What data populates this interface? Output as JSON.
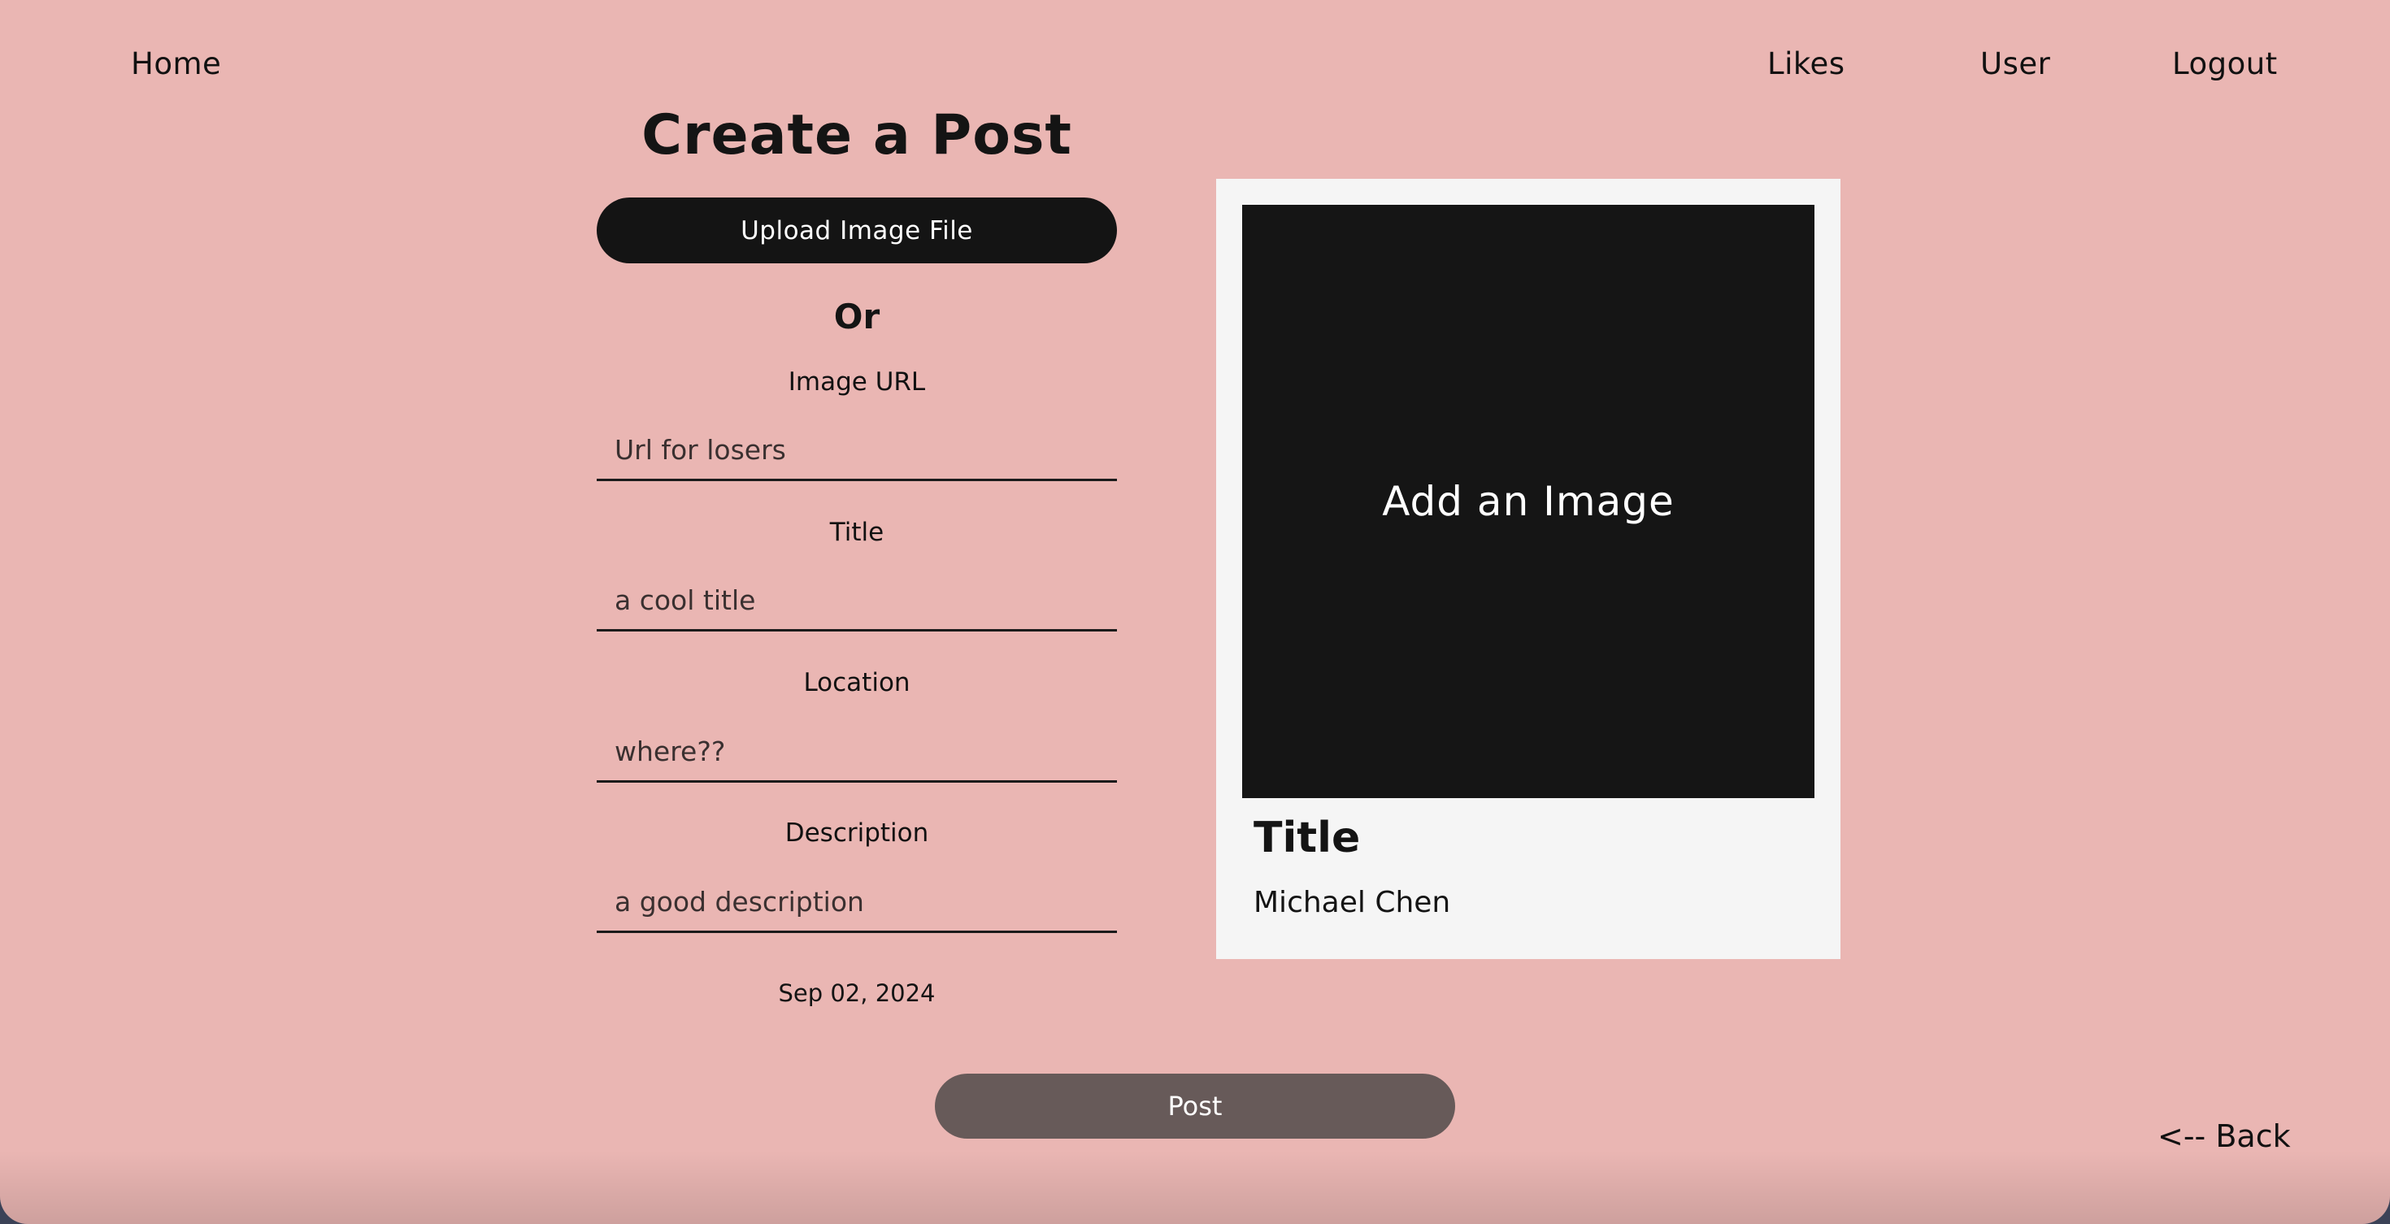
{
  "nav": {
    "home": "Home",
    "likes": "Likes",
    "user": "User",
    "logout": "Logout"
  },
  "form": {
    "heading": "Create a Post",
    "upload_label": "Upload Image File",
    "or_text": "Or",
    "fields": {
      "image_url": {
        "label": "Image URL",
        "placeholder": "Url for losers"
      },
      "title": {
        "label": "Title",
        "placeholder": "a cool title"
      },
      "location": {
        "label": "Location",
        "placeholder": "where??"
      },
      "description": {
        "label": "Description",
        "placeholder": "a good description"
      }
    },
    "date": "Sep 02, 2024",
    "post_label": "Post"
  },
  "preview": {
    "image_placeholder": "Add an Image",
    "title": "Title",
    "author": "Michael Chen"
  },
  "back_label": "<-- Back",
  "colors": {
    "background": "#eab6b3",
    "dark": "#141414",
    "post_button": "#675a59",
    "card": "#f5f5f5"
  }
}
